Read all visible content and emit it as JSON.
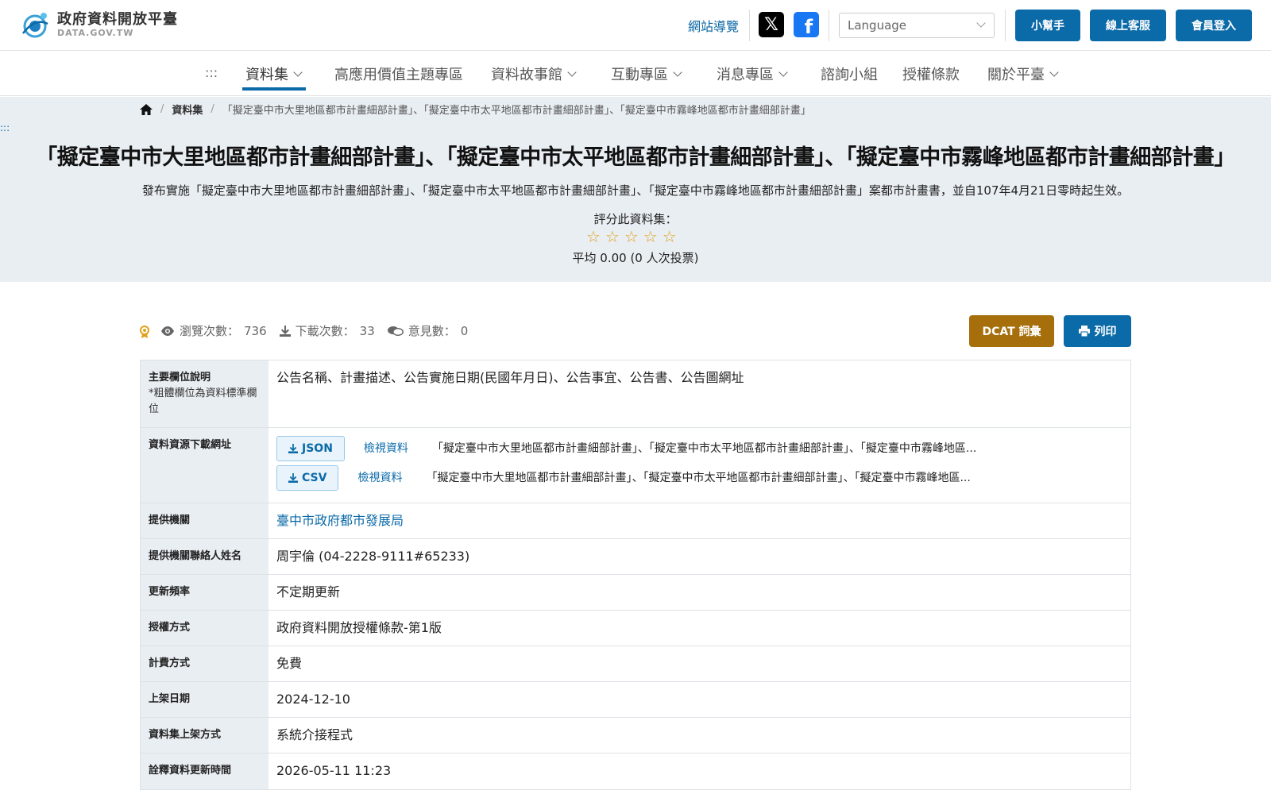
{
  "header": {
    "logo_title": "政府資料開放平臺",
    "logo_subtitle": "DATA.GOV.TW",
    "site_nav_label": "網站導覽",
    "language_placeholder": "Language",
    "helper_label": "小幫手",
    "support_label": "線上客服",
    "login_label": "會員登入"
  },
  "nav": {
    "dots": ":::",
    "items": [
      "資料集",
      "高應用價值主題專區",
      "資料故事館",
      "互動專區",
      "消息專區",
      "諮詢小組",
      "授權條款",
      "關於平臺"
    ]
  },
  "breadcrumb": {
    "datasets": "資料集",
    "current": "「擬定臺中市大里地區都市計畫細部計畫」、「擬定臺中市太平地區都市計畫細部計畫」、「擬定臺中市霧峰地區都市計畫細部計畫」"
  },
  "hero": {
    "anchor": ":::",
    "title": "「擬定臺中市大里地區都市計畫細部計畫」、「擬定臺中市太平地區都市計畫細部計畫」、「擬定臺中市霧峰地區都市計畫細部計畫」",
    "description": "發布實施「擬定臺中市大里地區都市計畫細部計畫」、「擬定臺中市太平地區都市計畫細部計畫」、「擬定臺中市霧峰地區都市計畫細部計畫」案都市計畫書，並自107年4月21日零時起生效。",
    "rate_label": "評分此資料集：",
    "rating": 0,
    "rating_max": 5,
    "rate_avg": "平均 0.00 (0 人次投票)"
  },
  "stats": {
    "views_label": "瀏覽次數：",
    "views": "736",
    "downloads_label": "下載次數：",
    "downloads": "33",
    "comments_label": "意見數：",
    "comments": "0",
    "dcat_label": "DCAT 詞彙",
    "print_label": "列印"
  },
  "table": {
    "main_fields": {
      "label": "主要欄位說明",
      "sub": "*粗體欄位為資料標準欄位",
      "value": "公告名稱、計畫描述、公告實施日期(民國年月日)、公告事宜、公告書、公告圖網址"
    },
    "resources": {
      "label": "資料資源下載網址",
      "items": [
        {
          "format": "JSON",
          "view": "檢視資料",
          "name": "「擬定臺中市大里地區都市計畫細部計畫」、「擬定臺中市太平地區都市計畫細部計畫」、「擬定臺中市霧峰地區..."
        },
        {
          "format": "CSV",
          "view": "檢視資料",
          "name": "「擬定臺中市大里地區都市計畫細部計畫」、「擬定臺中市太平地區都市計畫細部計畫」、「擬定臺中市霧峰地區..."
        }
      ]
    },
    "provider": {
      "label": "提供機關",
      "value": "臺中市政府都市發展局"
    },
    "contact": {
      "label": "提供機關聯絡人姓名",
      "value": "周宇倫 (04-2228-9111#65233)"
    },
    "frequency": {
      "label": "更新頻率",
      "value": "不定期更新"
    },
    "license": {
      "label": "授權方式",
      "value": "政府資料開放授權條款-第1版"
    },
    "fee": {
      "label": "計費方式",
      "value": "免費"
    },
    "published": {
      "label": "上架日期",
      "value": "2024-12-10"
    },
    "method": {
      "label": "資料集上架方式",
      "value": "系統介接程式"
    },
    "metadata_updated": {
      "label": "詮釋資料更新時間",
      "value": "2026-05-11 11:23"
    }
  },
  "colors": {
    "primary": "#0b6aa8",
    "dcat": "#a66f0c",
    "hero_bg": "#e9eef3",
    "star": "#e0a21a"
  }
}
